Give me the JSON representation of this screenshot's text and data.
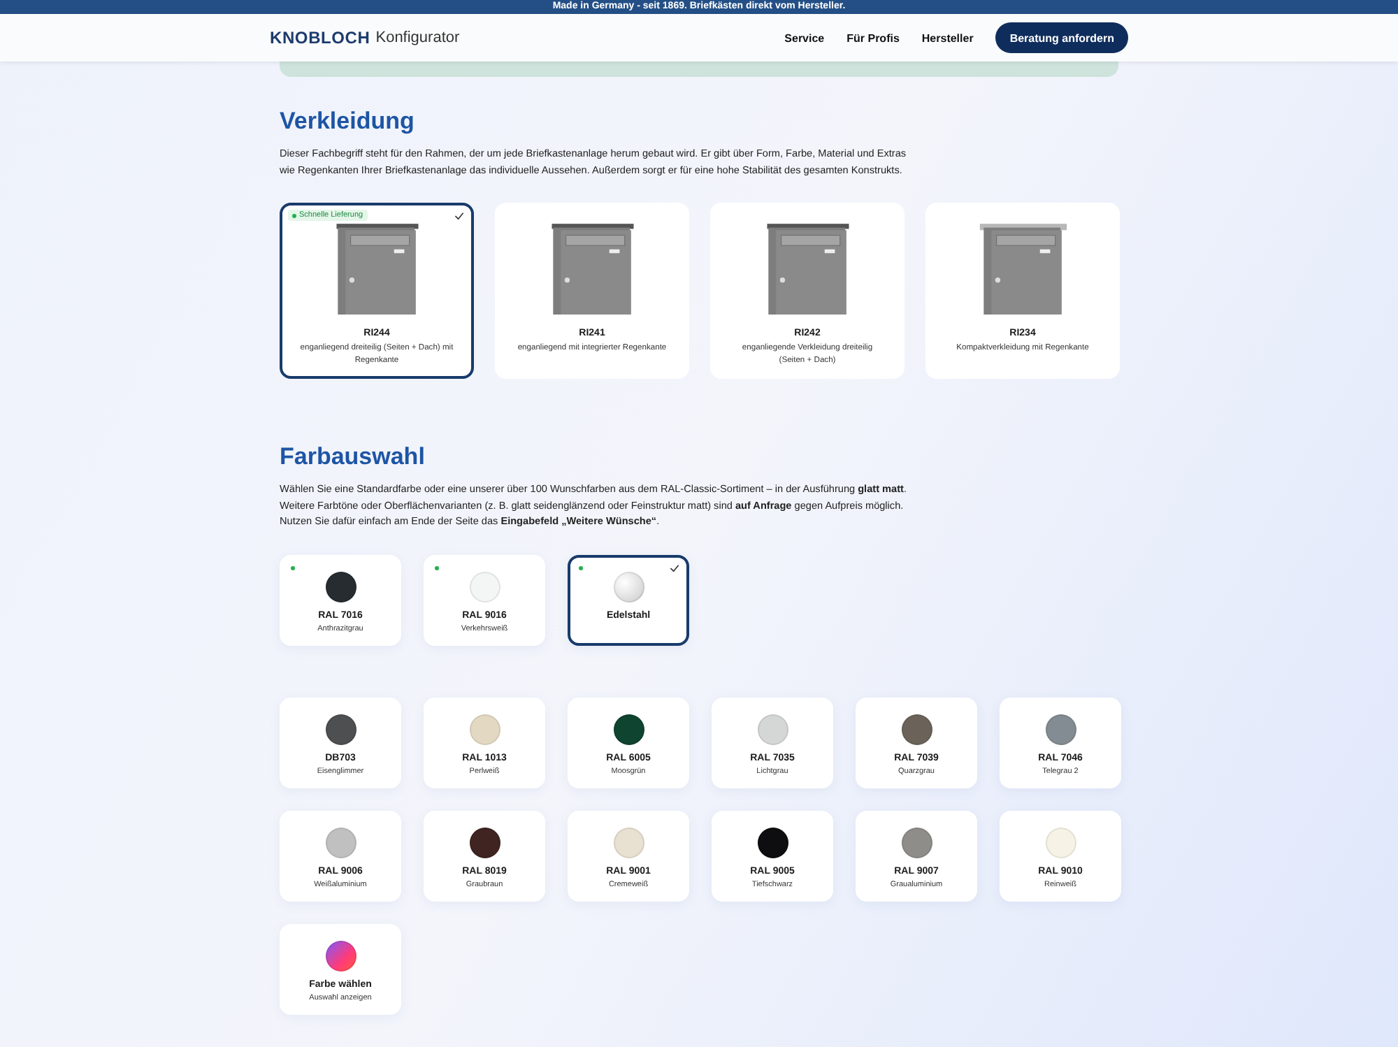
{
  "top_banner": "Made in Germany - seit 1869. Briefkästen direkt vom Hersteller.",
  "header": {
    "brand": "KNOBLOCH",
    "brand_suffix": "Konfigurator",
    "nav": [
      "Service",
      "Für Profis",
      "Hersteller"
    ],
    "cta": "Beratung anfordern"
  },
  "cladding": {
    "title": "Verkleidung",
    "description": "Dieser Fachbegriff steht für den Rahmen, der um jede Briefkastenanlage herum gebaut wird. Er gibt über Form, Farbe, Material und Extras wie Regenkanten Ihrer Briefkastenanlage das individuelle Aussehen. Außerdem sorgt er für eine hohe Stabilität des gesamten Konstrukts.",
    "options": [
      {
        "code": "RI244",
        "label": "enganliegend dreiteilig (Seiten + Dach) mit Regenkante",
        "badge": "Schnelle Lieferung",
        "selected": true,
        "kind": "roof"
      },
      {
        "code": "RI241",
        "label": "enganliegend mit integrierter Regenkante",
        "selected": false,
        "kind": "roof"
      },
      {
        "code": "RI242",
        "label": "enganliegende Verkleidung dreiteilig (Seiten + Dach)",
        "selected": false,
        "kind": "roof"
      },
      {
        "code": "RI234",
        "label": "Kompaktverkleidung mit Regenkante",
        "selected": false,
        "kind": "compact"
      }
    ]
  },
  "colors": {
    "title": "Farbauswahl",
    "description": "Wählen Sie eine Standardfarbe oder eine unserer über 100 Wunschfarben aus dem RAL-Classic-Sortiment – in der Ausführung **glatt matt**. Weitere Farbtöne oder Oberflächenvarianten (z. B. glatt seidenglänzend oder Feinstruktur matt) sind **auf Anfrage** gegen Aufpreis möglich. Nutzen Sie dafür einfach am Ende der Seite das **Eingabefeld „Weitere Wünsche“**.",
    "standard": [
      {
        "code": "RAL 7016",
        "name": "Anthrazitgrau",
        "color": "#262c30",
        "fast_delivery": true,
        "selected": false,
        "kind": "solid"
      },
      {
        "code": "RAL 9016",
        "name": "Verkehrsweiß",
        "color": "#f4f5f5",
        "fast_delivery": true,
        "selected": false,
        "kind": "solid"
      },
      {
        "code": "Edelstahl",
        "color": "#d8d8d8",
        "fast_delivery": true,
        "selected": true,
        "kind": "metal"
      }
    ],
    "palette": [
      {
        "code": "DB703",
        "name": "Eisenglimmer",
        "color": "#4e4f51",
        "kind": "solid"
      },
      {
        "code": "RAL 1013",
        "name": "Perlweiß",
        "color": "#e3d9c3",
        "kind": "solid"
      },
      {
        "code": "RAL 6005",
        "name": "Moosgrün",
        "color": "#0f4430",
        "kind": "solid"
      },
      {
        "code": "RAL 7035",
        "name": "Lichtgrau",
        "color": "#d5d7d6",
        "kind": "solid"
      },
      {
        "code": "RAL 7039",
        "name": "Quarzgrau",
        "color": "#6b635a",
        "kind": "solid"
      },
      {
        "code": "RAL 7046",
        "name": "Telegrau 2",
        "color": "#838c92",
        "kind": "solid"
      },
      {
        "code": "RAL 9006",
        "name": "Weißaluminium",
        "color": "#bfc0bf",
        "kind": "solid"
      },
      {
        "code": "RAL 8019",
        "name": "Graubraun",
        "color": "#3f2422",
        "kind": "solid"
      },
      {
        "code": "RAL 9001",
        "name": "Cremeweiß",
        "color": "#e8e0d0",
        "kind": "solid"
      },
      {
        "code": "RAL 9005",
        "name": "Tiefschwarz",
        "color": "#0e0e10",
        "kind": "solid"
      },
      {
        "code": "RAL 9007",
        "name": "Graualuminium",
        "color": "#8e8d8a",
        "kind": "solid"
      },
      {
        "code": "RAL 9010",
        "name": "Reinweiß",
        "color": "#f6f3e6",
        "kind": "solid"
      },
      {
        "code": "Farbe wählen",
        "name": "Auswahl anzeigen",
        "kind": "custom"
      }
    ]
  }
}
